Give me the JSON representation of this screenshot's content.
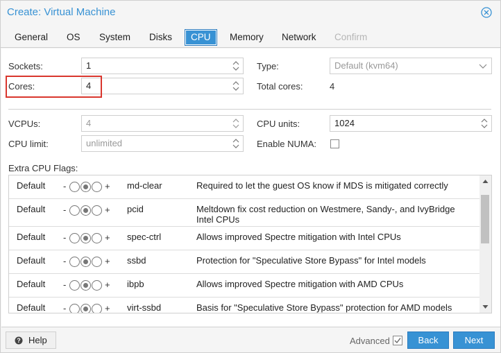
{
  "window": {
    "title": "Create: Virtual Machine"
  },
  "tabs": [
    {
      "label": "General",
      "state": "normal"
    },
    {
      "label": "OS",
      "state": "normal"
    },
    {
      "label": "System",
      "state": "normal"
    },
    {
      "label": "Disks",
      "state": "normal"
    },
    {
      "label": "CPU",
      "state": "active"
    },
    {
      "label": "Memory",
      "state": "normal"
    },
    {
      "label": "Network",
      "state": "normal"
    },
    {
      "label": "Confirm",
      "state": "disabled"
    }
  ],
  "form": {
    "sockets": {
      "label": "Sockets:",
      "value": "1"
    },
    "type": {
      "label": "Type:",
      "value": "Default (kvm64)"
    },
    "cores": {
      "label": "Cores:",
      "value": "4"
    },
    "total_cores": {
      "label": "Total cores:",
      "value": "4"
    },
    "vcpus": {
      "label": "VCPUs:",
      "value": "4"
    },
    "cpu_units": {
      "label": "CPU units:",
      "value": "1024"
    },
    "cpu_limit": {
      "label": "CPU limit:",
      "value": "unlimited"
    },
    "enable_numa": {
      "label": "Enable NUMA:",
      "checked": false
    }
  },
  "flags": {
    "label": "Extra CPU Flags:",
    "rows": [
      {
        "state": "Default",
        "minus": "-",
        "plus": "+",
        "name": "md-clear",
        "desc": "Required to let the guest OS know if MDS is mitigated correctly"
      },
      {
        "state": "Default",
        "minus": "-",
        "plus": "+",
        "name": "pcid",
        "desc": "Meltdown fix cost reduction on Westmere, Sandy-, and IvyBridge Intel CPUs"
      },
      {
        "state": "Default",
        "minus": "-",
        "plus": "+",
        "name": "spec-ctrl",
        "desc": "Allows improved Spectre mitigation with Intel CPUs"
      },
      {
        "state": "Default",
        "minus": "-",
        "plus": "+",
        "name": "ssbd",
        "desc": "Protection for \"Speculative Store Bypass\" for Intel models"
      },
      {
        "state": "Default",
        "minus": "-",
        "plus": "+",
        "name": "ibpb",
        "desc": "Allows improved Spectre mitigation with AMD CPUs"
      },
      {
        "state": "Default",
        "minus": "-",
        "plus": "+",
        "name": "virt-ssbd",
        "desc": "Basis for \"Speculative Store Bypass\" protection for AMD models"
      }
    ]
  },
  "footer": {
    "help_label": "Help",
    "advanced_label": "Advanced",
    "advanced_checked": true,
    "back_label": "Back",
    "next_label": "Next"
  },
  "colors": {
    "accent": "#3892d4",
    "highlight": "#d9362d"
  },
  "icons": [
    "close-icon",
    "spinner-icon",
    "dropdown-chevron-icon",
    "help-icon",
    "checkbox-icon",
    "scroll-up-icon",
    "scroll-down-icon"
  ]
}
